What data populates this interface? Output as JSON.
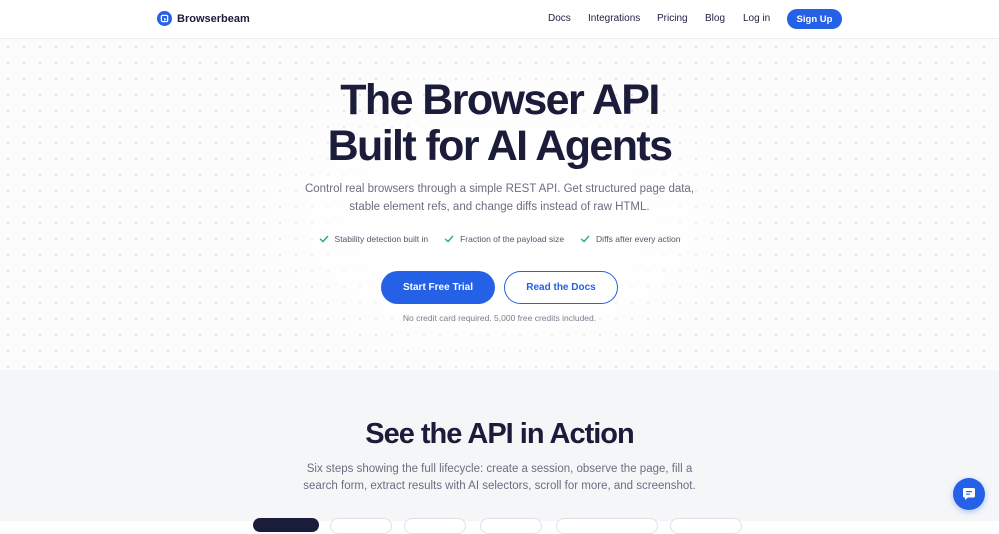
{
  "brand": {
    "name": "Browserbeam",
    "icon": "browserbeam-logo-icon"
  },
  "nav": {
    "links": [
      {
        "label": "Docs"
      },
      {
        "label": "Integrations"
      },
      {
        "label": "Pricing"
      },
      {
        "label": "Blog"
      },
      {
        "label": "Log in"
      }
    ],
    "signup": "Sign Up"
  },
  "hero": {
    "title_line1": "The Browser API",
    "title_line2": "Built for AI Agents",
    "subtitle_line1": "Control real browsers through a simple REST API. Get structured page data,",
    "subtitle_line2": "stable element refs, and change diffs instead of raw HTML.",
    "features": [
      {
        "label": "Stability detection built in",
        "icon": "check-icon"
      },
      {
        "label": "Fraction of the payload size",
        "icon": "check-icon"
      },
      {
        "label": "Diffs after every action",
        "icon": "check-icon"
      }
    ],
    "primary_button": "Start Free Trial",
    "secondary_button": "Read the Docs",
    "note": "No credit card required. 5,000 free credits included."
  },
  "action": {
    "title": "See the API in Action",
    "subtitle_line1": "Six steps showing the full lifecycle: create a session, observe the page, fill a",
    "subtitle_line2": "search form, extract results with AI selectors, scroll for more, and screenshot."
  },
  "chat": {
    "icon": "chat-bubble-icon"
  },
  "colors": {
    "accent": "#2461e6",
    "heading": "#1b1c3a",
    "check": "#22b07d",
    "section_bg": "#f5f6f8"
  }
}
